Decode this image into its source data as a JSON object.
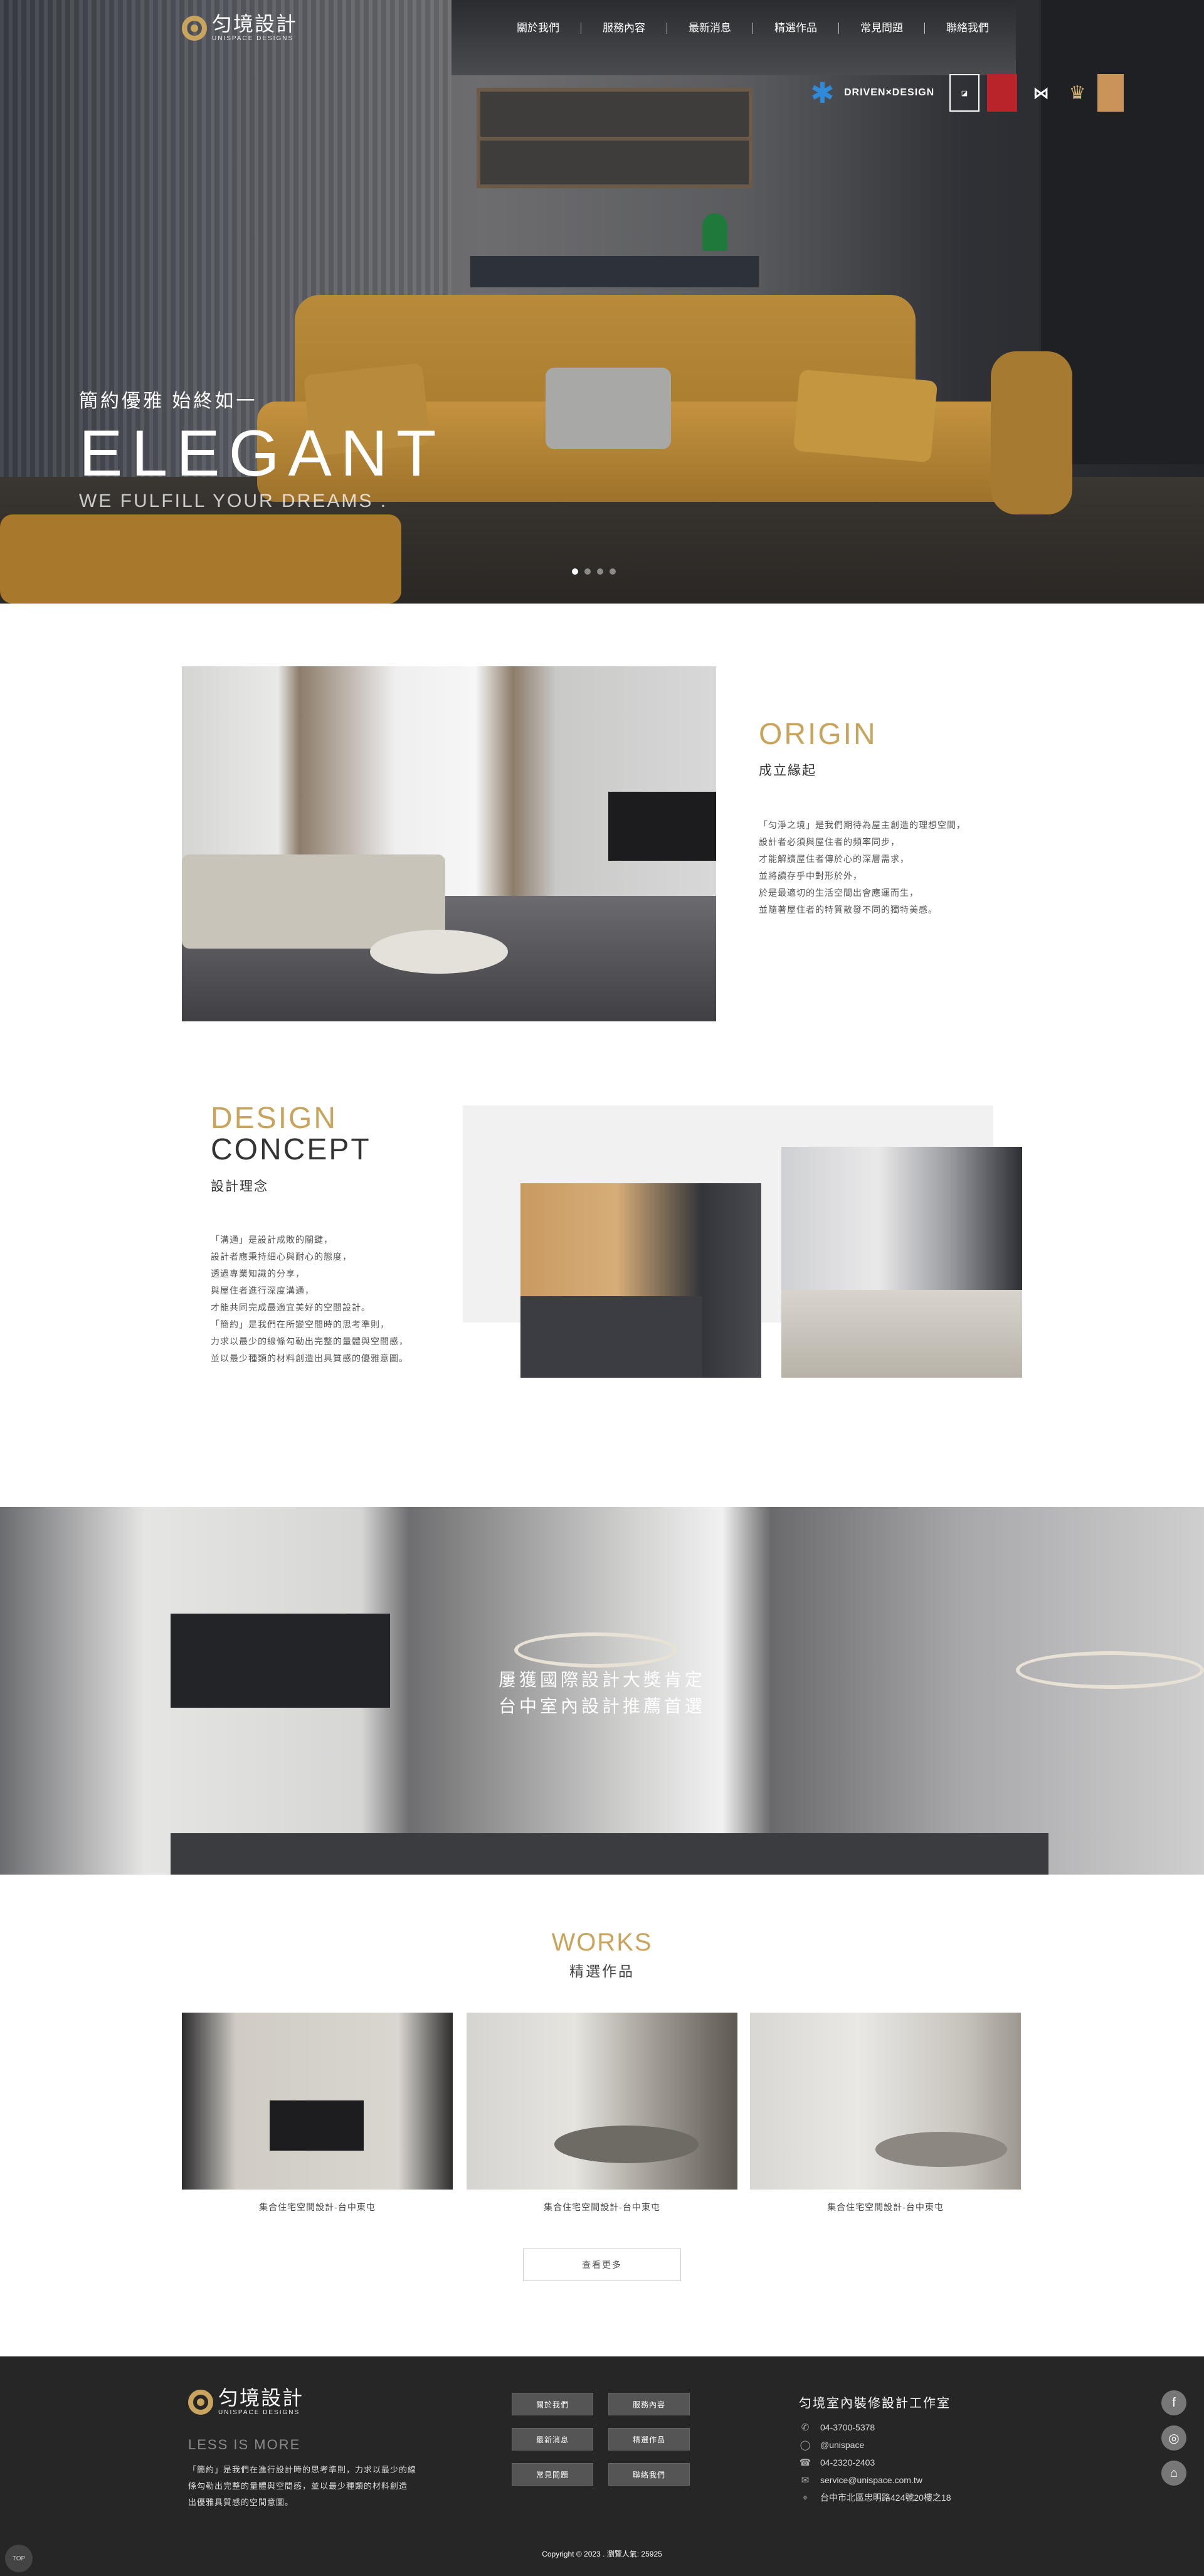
{
  "brand": {
    "name": "匀境設計",
    "sub": "UNISPACE DESIGNS",
    "accent": "#c9a45c"
  },
  "nav": [
    "關於我們",
    "服務內容",
    "最新消息",
    "精選作品",
    "常見問題",
    "聯絡我們"
  ],
  "awards": [
    {
      "icon": "design-award-figure-icon",
      "label": "DRIVEN×DESIGN"
    },
    {
      "icon": "award-logo-box-icon",
      "label": ""
    },
    {
      "icon": "award-logo-red-icon",
      "label": ""
    },
    {
      "icon": "award-logo-mv-icon",
      "label": ""
    },
    {
      "icon": "award-logo-gold-icon",
      "label": ""
    },
    {
      "icon": "award-logo-tan-icon",
      "label": ""
    }
  ],
  "hero": {
    "cn": "簡約優雅 始終如一",
    "en": "ELEGANT",
    "sub": "WE FULFILL YOUR DREAMS .",
    "slides": 4,
    "active_slide": 0
  },
  "origin": {
    "en": "ORIGIN",
    "cn": "成立緣起",
    "lines": [
      "「匀淨之境」是我們期待為屋主創造的理想空間，",
      "設計者必須與屋住者的頻率同步，",
      "才能解讀屋住者傳於心的深層需求，",
      "並將讀存乎中對形於外，",
      "於是最適切的生活空間出會應運而生，",
      "並隨著屋住者的特質散發不同的獨特美感。"
    ]
  },
  "concept": {
    "en1": "DESIGN",
    "en2": "CONCEPT",
    "cn": "設計理念",
    "lines": [
      "「溝通」是設計成敗的關鍵，",
      "設計者應秉持細心與耐心的態度，",
      "透過專業知識的分享，",
      "與屋住者進行深度溝通，",
      "才能共同完成最適宜美好的空間設計。",
      "「簡約」是我們在所變空間時的思考準則，",
      "力求以最少的線條勾勒出完整的量體與空間感，",
      "並以最少種類的材料創造出具質感的優雅意圖。"
    ]
  },
  "banner": {
    "line1": "屢獲國際設計大獎肯定",
    "line2": "台中室內設計推薦首選"
  },
  "works": {
    "en": "WORKS",
    "cn": "精選作品",
    "items": [
      {
        "caption": "集合住宅空間設計-台中東屯"
      },
      {
        "caption": "集合住宅空間設計-台中東屯"
      },
      {
        "caption": "集合住宅空間設計-台中東屯"
      }
    ],
    "more": "查看更多"
  },
  "footer": {
    "slogan": "LESS IS MORE",
    "intro": [
      "「簡約」是我們在進行設計時的思考準則，力求以最少的線",
      "條勾勒出完整的量體與空間感，並以最少種類的材料創造",
      "出優雅具質感的空間意圖。"
    ],
    "buttons": [
      "關於我們",
      "服務內容",
      "最新消息",
      "精選作品",
      "常見問題",
      "聯絡我們"
    ],
    "contact_title": "匀境室內裝修設計工作室",
    "contacts": [
      {
        "icon": "phone-icon",
        "glyph": "✆",
        "text": "04-3700-5378"
      },
      {
        "icon": "line-icon",
        "glyph": "◯",
        "text": "@unispace"
      },
      {
        "icon": "fax-icon",
        "glyph": "☎",
        "text": "04-2320-2403"
      },
      {
        "icon": "mail-icon",
        "glyph": "✉",
        "text": "service@unispace.com.tw"
      },
      {
        "icon": "location-icon",
        "glyph": "⌖",
        "text": "台中市北區忠明路424號20樓之18"
      }
    ],
    "social": [
      {
        "icon": "facebook-icon",
        "glyph": "f"
      },
      {
        "icon": "line-icon",
        "glyph": "◎"
      },
      {
        "icon": "map-icon",
        "glyph": "⌂"
      }
    ],
    "copyright": "Copyright © 2023 . 瀏覽人氣: 25925",
    "top": "TOP"
  }
}
